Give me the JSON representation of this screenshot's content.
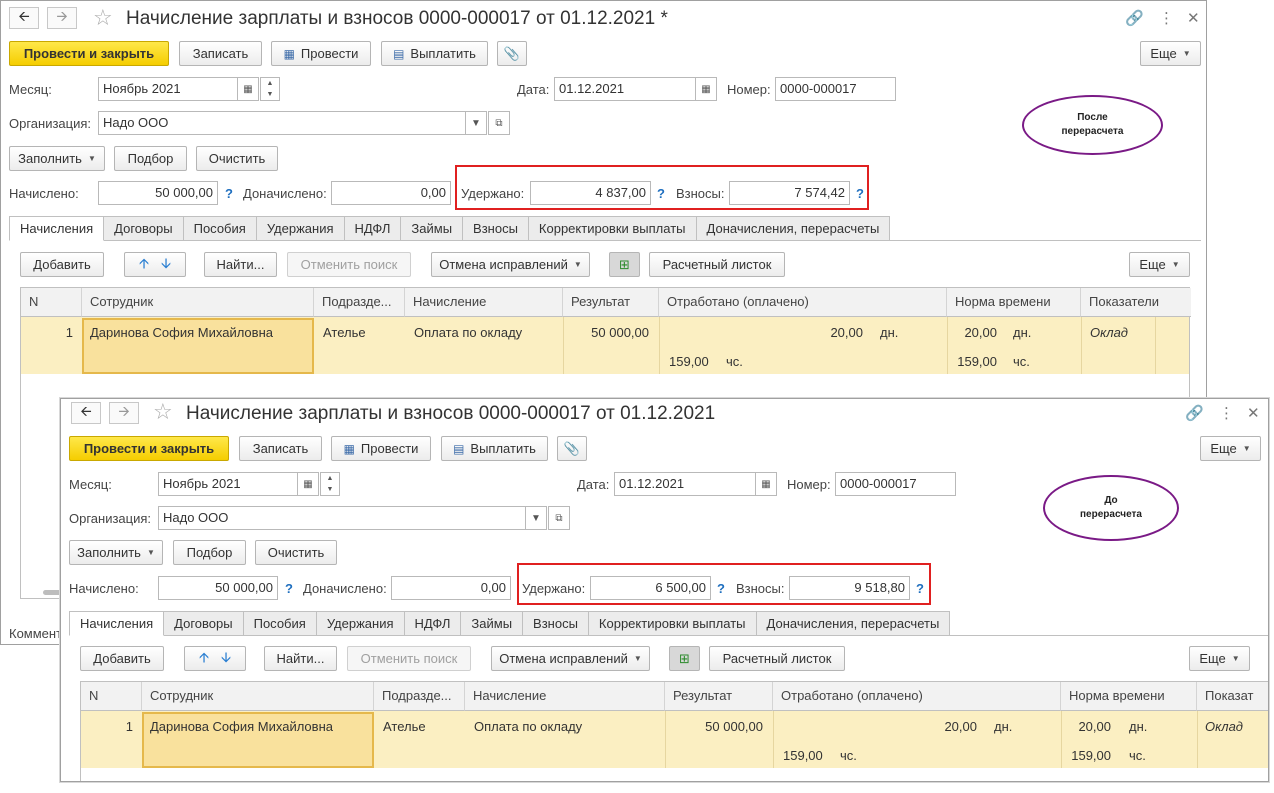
{
  "after": {
    "title": "Начисление зарплаты и взносов 0000-000017 от 01.12.2021 *",
    "annotation": "После\nперерасчета",
    "toolbar": {
      "post_close": "Провести и закрыть",
      "save": "Записать",
      "post": "Провести",
      "pay": "Выплатить",
      "more": "Еще"
    },
    "month_label": "Месяц:",
    "month_value": "Ноябрь 2021",
    "date_label": "Дата:",
    "date_value": "01.12.2021",
    "number_label": "Номер:",
    "number_value": "0000-000017",
    "org_label": "Организация:",
    "org_value": "Надо ООО",
    "fill_btn": "Заполнить",
    "select_btn": "Подбор",
    "clear_btn": "Очистить",
    "accrued_label": "Начислено:",
    "accrued_value": "50 000,00",
    "extra_label": "Доначислено:",
    "extra_value": "0,00",
    "withheld_label": "Удержано:",
    "withheld_value": "4 837,00",
    "contrib_label": "Взносы:",
    "contrib_value": "7 574,42",
    "help": "?",
    "tabs": [
      "Начисления",
      "Договоры",
      "Пособия",
      "Удержания",
      "НДФЛ",
      "Займы",
      "Взносы",
      "Корректировки выплаты",
      "Доначисления, перерасчеты"
    ],
    "grid_toolbar": {
      "add": "Добавить",
      "find": "Найти...",
      "cancel_search": "Отменить поиск",
      "cancel_fixes": "Отмена исправлений",
      "payslip": "Расчетный листок",
      "more": "Еще"
    },
    "columns": [
      "N",
      "Сотрудник",
      "Подразде...",
      "Начисление",
      "Результат",
      "Отработано (оплачено)",
      "Норма времени",
      "Показатели"
    ],
    "row": {
      "n": "1",
      "employee": "Даринова София Михайловна",
      "department": "Ателье",
      "accrual": "Оплата по окладу",
      "result": "50 000,00",
      "worked_days": "20,00",
      "days_unit": "дн.",
      "worked_hours": "159,00",
      "hours_unit": "чс.",
      "norm_days": "20,00",
      "norm_days_unit": "дн.",
      "norm_hours": "159,00",
      "norm_hours_unit": "чс.",
      "indicator": "Оклад"
    },
    "comment_label": "Коммент"
  },
  "before": {
    "title": "Начисление зарплаты и взносов 0000-000017 от 01.12.2021",
    "annotation": "До\nперерасчета",
    "toolbar": {
      "post_close": "Провести и закрыть",
      "save": "Записать",
      "post": "Провести",
      "pay": "Выплатить",
      "more": "Еще"
    },
    "month_label": "Месяц:",
    "month_value": "Ноябрь 2021",
    "date_label": "Дата:",
    "date_value": "01.12.2021",
    "number_label": "Номер:",
    "number_value": "0000-000017",
    "org_label": "Организация:",
    "org_value": "Надо ООО",
    "fill_btn": "Заполнить",
    "select_btn": "Подбор",
    "clear_btn": "Очистить",
    "accrued_label": "Начислено:",
    "accrued_value": "50 000,00",
    "extra_label": "Доначислено:",
    "extra_value": "0,00",
    "withheld_label": "Удержано:",
    "withheld_value": "6 500,00",
    "contrib_label": "Взносы:",
    "contrib_value": "9 518,80",
    "help": "?",
    "tabs": [
      "Начисления",
      "Договоры",
      "Пособия",
      "Удержания",
      "НДФЛ",
      "Займы",
      "Взносы",
      "Корректировки выплаты",
      "Доначисления, перерасчеты"
    ],
    "grid_toolbar": {
      "add": "Добавить",
      "find": "Найти...",
      "cancel_search": "Отменить поиск",
      "cancel_fixes": "Отмена исправлений",
      "payslip": "Расчетный листок",
      "more": "Еще"
    },
    "columns": [
      "N",
      "Сотрудник",
      "Подразде...",
      "Начисление",
      "Результат",
      "Отработано (оплачено)",
      "Норма времени",
      "Показат"
    ],
    "row": {
      "n": "1",
      "employee": "Даринова София Михайловна",
      "department": "Ателье",
      "accrual": "Оплата по окладу",
      "result": "50 000,00",
      "worked_days": "20,00",
      "days_unit": "дн.",
      "worked_hours": "159,00",
      "hours_unit": "чс.",
      "norm_days": "20,00",
      "norm_days_unit": "дн.",
      "norm_hours": "159,00",
      "norm_hours_unit": "чс.",
      "indicator": "Оклад"
    }
  },
  "colors": {
    "primary_button": "#f5cd00",
    "highlight_box": "#e02020",
    "annotation_oval": "#7a1a86",
    "row_highlight": "#fbefc2",
    "help_icon": "#1f6fbf"
  }
}
